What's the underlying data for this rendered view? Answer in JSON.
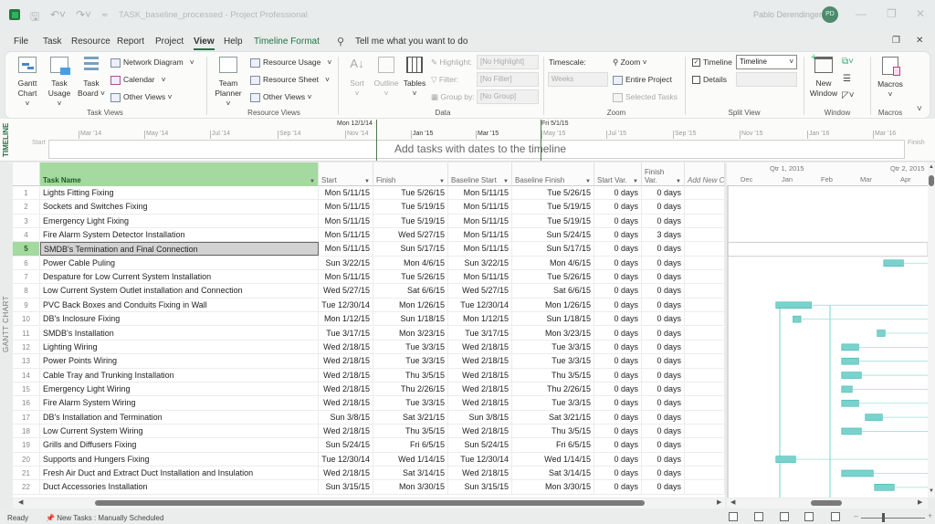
{
  "window": {
    "title": "TASK_baseline_processed - Project Professional",
    "user_name": "Pablo Derendinger",
    "user_initials": "PD",
    "quick_access": [
      "save-icon",
      "undo-icon",
      "redo-icon",
      "customize-icon"
    ],
    "controls": {
      "minimize": "—",
      "restore": "❐",
      "close": "✕"
    }
  },
  "menu": {
    "tabs": [
      "File",
      "Task",
      "Resource",
      "Report",
      "Project",
      "View",
      "Help",
      "Timeline Format"
    ],
    "active": "View",
    "search_placeholder": "Tell me what you want to do",
    "ribbon_restore": "❐",
    "ribbon_close": "✕"
  },
  "ribbon": {
    "task_views": {
      "label": "Task Views",
      "gantt_chart": [
        "Gantt",
        "Chart ˅"
      ],
      "task_usage": [
        "Task",
        "Usage ˅"
      ],
      "task_board": [
        "Task",
        "Board ˅"
      ],
      "network_diagram": "Network Diagram",
      "calendar": "Calendar",
      "other_views": "Other Views ˅"
    },
    "resource_views": {
      "label": "Resource Views",
      "team_planner": [
        "Team",
        "Planner ˅"
      ],
      "resource_usage": "Resource Usage",
      "resource_sheet": "Resource Sheet",
      "other_views": "Other Views ˅"
    },
    "data": {
      "label": "Data",
      "sort": "Sort",
      "outline": "Outline",
      "tables": "Tables",
      "highlight_label": "Highlight:",
      "highlight_value": "[No Highlight]",
      "filter_label": "Filter:",
      "filter_value": "[No Filter]",
      "group_label": "Group by:",
      "group_value": "[No Group]"
    },
    "zoom": {
      "label": "Zoom",
      "timescale_label": "Timescale:",
      "timescale_value": "Weeks",
      "zoom_btn": "Zoom ˅",
      "entire_project": "Entire Project",
      "selected_tasks": "Selected Tasks"
    },
    "split_view": {
      "label": "Split View",
      "timeline_label": "Timeline",
      "timeline_checked": true,
      "timeline_value": "Timeline",
      "details_label": "Details",
      "details_checked": false
    },
    "window": {
      "label": "Window",
      "new_window": [
        "New",
        "Window"
      ]
    },
    "macros": {
      "label": "Macros",
      "macros_btn": "Macros"
    }
  },
  "timeline": {
    "side_label": "TIMELINE",
    "start_label": "Start",
    "finish_label": "Finish",
    "hint": "Add tasks with dates to the timeline",
    "view_start": "Mon 12/1/14",
    "view_finish": "Fri 5/1/15",
    "ticks": [
      "Mar '14",
      "May '14",
      "Jul '14",
      "Sep '14",
      "Nov '14",
      "Jan '15",
      "Mar '15",
      "May '15",
      "Jul '15",
      "Sep '15",
      "Nov '15",
      "Jan '16",
      "Mar '16"
    ]
  },
  "grid": {
    "side_label": "GANTT CHART",
    "columns": {
      "task_name": "Task Name",
      "start": "Start",
      "finish": "Finish",
      "baseline_start": "Baseline Start",
      "baseline_finish": "Baseline Finish",
      "start_var": "Start Var.",
      "finish_var": [
        "Finish",
        "Var."
      ],
      "add_new": "Add New Column"
    },
    "selected_row": 5,
    "rows": [
      {
        "id": "1",
        "name": "Lights Fitting Fixing",
        "start": "Mon 5/11/15",
        "finish": "Tue 5/26/15",
        "bstart": "Mon 5/11/15",
        "bfinish": "Tue 5/26/15",
        "sv": "0 days",
        "fv": "0 days"
      },
      {
        "id": "2",
        "name": "Sockets and Switches Fixing",
        "start": "Mon 5/11/15",
        "finish": "Tue 5/19/15",
        "bstart": "Mon 5/11/15",
        "bfinish": "Tue 5/19/15",
        "sv": "0 days",
        "fv": "0 days"
      },
      {
        "id": "3",
        "name": "Emergency Light Fixing",
        "start": "Mon 5/11/15",
        "finish": "Tue 5/19/15",
        "bstart": "Mon 5/11/15",
        "bfinish": "Tue 5/19/15",
        "sv": "0 days",
        "fv": "0 days"
      },
      {
        "id": "4",
        "name": "Fire Alarm System Detector Installation",
        "start": "Mon 5/11/15",
        "finish": "Wed 5/27/15",
        "bstart": "Mon 5/11/15",
        "bfinish": "Sun 5/24/15",
        "sv": "0 days",
        "fv": "3 days"
      },
      {
        "id": "5",
        "name": "SMDB's  Termination and Final Connection",
        "start": "Mon 5/11/15",
        "finish": "Sun 5/17/15",
        "bstart": "Mon 5/11/15",
        "bfinish": "Sun 5/17/15",
        "sv": "0 days",
        "fv": "0 days"
      },
      {
        "id": "6",
        "name": "Power Cable Puling",
        "start": "Sun 3/22/15",
        "finish": "Mon 4/6/15",
        "bstart": "Sun 3/22/15",
        "bfinish": "Mon 4/6/15",
        "sv": "0 days",
        "fv": "0 days"
      },
      {
        "id": "7",
        "name": "Despature for Low Current  System Installation",
        "start": "Mon 5/11/15",
        "finish": "Tue 5/26/15",
        "bstart": "Mon 5/11/15",
        "bfinish": "Tue 5/26/15",
        "sv": "0 days",
        "fv": "0 days"
      },
      {
        "id": "8",
        "name": "Low Current  System Outlet installation and Connection",
        "start": "Wed 5/27/15",
        "finish": "Sat 6/6/15",
        "bstart": "Wed 5/27/15",
        "bfinish": "Sat 6/6/15",
        "sv": "0 days",
        "fv": "0 days"
      },
      {
        "id": "9",
        "name": "PVC Back Boxes and Conduits  Fixing in Wall",
        "start": "Tue 12/30/14",
        "finish": "Mon 1/26/15",
        "bstart": "Tue 12/30/14",
        "bfinish": "Mon 1/26/15",
        "sv": "0 days",
        "fv": "0 days"
      },
      {
        "id": "10",
        "name": "DB's Inclosure Fixing",
        "start": "Mon 1/12/15",
        "finish": "Sun 1/18/15",
        "bstart": "Mon 1/12/15",
        "bfinish": "Sun 1/18/15",
        "sv": "0 days",
        "fv": "0 days"
      },
      {
        "id": "11",
        "name": "SMDB's  Installation",
        "start": "Tue 3/17/15",
        "finish": "Mon 3/23/15",
        "bstart": "Tue 3/17/15",
        "bfinish": "Mon 3/23/15",
        "sv": "0 days",
        "fv": "0 days"
      },
      {
        "id": "12",
        "name": "Lighting  Wiring",
        "start": "Wed 2/18/15",
        "finish": "Tue 3/3/15",
        "bstart": "Wed 2/18/15",
        "bfinish": "Tue 3/3/15",
        "sv": "0 days",
        "fv": "0 days"
      },
      {
        "id": "13",
        "name": "Power Points Wiring",
        "start": "Wed 2/18/15",
        "finish": "Tue 3/3/15",
        "bstart": "Wed 2/18/15",
        "bfinish": "Tue 3/3/15",
        "sv": "0 days",
        "fv": "0 days"
      },
      {
        "id": "14",
        "name": "Cable Tray and Trunking Installation",
        "start": "Wed 2/18/15",
        "finish": "Thu 3/5/15",
        "bstart": "Wed 2/18/15",
        "bfinish": "Thu 3/5/15",
        "sv": "0 days",
        "fv": "0 days"
      },
      {
        "id": "15",
        "name": "Emergency Light Wiring",
        "start": "Wed 2/18/15",
        "finish": "Thu 2/26/15",
        "bstart": "Wed 2/18/15",
        "bfinish": "Thu 2/26/15",
        "sv": "0 days",
        "fv": "0 days"
      },
      {
        "id": "16",
        "name": "Fire Alarm System Wiring",
        "start": "Wed 2/18/15",
        "finish": "Tue 3/3/15",
        "bstart": "Wed 2/18/15",
        "bfinish": "Tue 3/3/15",
        "sv": "0 days",
        "fv": "0 days"
      },
      {
        "id": "17",
        "name": "DB's Installation and Termination",
        "start": "Sun 3/8/15",
        "finish": "Sat 3/21/15",
        "bstart": "Sun 3/8/15",
        "bfinish": "Sat 3/21/15",
        "sv": "0 days",
        "fv": "0 days"
      },
      {
        "id": "18",
        "name": "Low Current  System Wiring",
        "start": "Wed 2/18/15",
        "finish": "Thu 3/5/15",
        "bstart": "Wed 2/18/15",
        "bfinish": "Thu 3/5/15",
        "sv": "0 days",
        "fv": "0 days"
      },
      {
        "id": "19",
        "name": "Grills and Diffusers Fixing",
        "start": "Sun 5/24/15",
        "finish": "Fri 6/5/15",
        "bstart": "Sun 5/24/15",
        "bfinish": "Fri 6/5/15",
        "sv": "0 days",
        "fv": "0 days"
      },
      {
        "id": "20",
        "name": "Supports and Hungers Fixing",
        "start": "Tue 12/30/14",
        "finish": "Wed 1/14/15",
        "bstart": "Tue 12/30/14",
        "bfinish": "Wed 1/14/15",
        "sv": "0 days",
        "fv": "0 days"
      },
      {
        "id": "21",
        "name": "Fresh Air Duct and Extract Duct Installation and Insulation",
        "start": "Wed 2/18/15",
        "finish": "Sat 3/14/15",
        "bstart": "Wed 2/18/15",
        "bfinish": "Sat 3/14/15",
        "sv": "0 days",
        "fv": "0 days"
      },
      {
        "id": "22",
        "name": "Duct Accessories Installation",
        "start": "Sun 3/15/15",
        "finish": "Mon 3/30/15",
        "bstart": "Sun 3/15/15",
        "bfinish": "Mon 3/30/15",
        "sv": "0 days",
        "fv": "0 days"
      }
    ]
  },
  "chart": {
    "quarters": [
      "Qtr 1, 2015",
      "Qtr 2, 2015"
    ],
    "months": [
      "Dec",
      "Jan",
      "Feb",
      "Mar",
      "Apr"
    ],
    "bar_color": "#78d3cd"
  },
  "status": {
    "ready": "Ready",
    "new_tasks": "New Tasks : Manually Scheduled"
  },
  "colors": {
    "accent": "#217346",
    "header_green": "#a4d9a0",
    "gantt_bar": "#78d3cd"
  }
}
